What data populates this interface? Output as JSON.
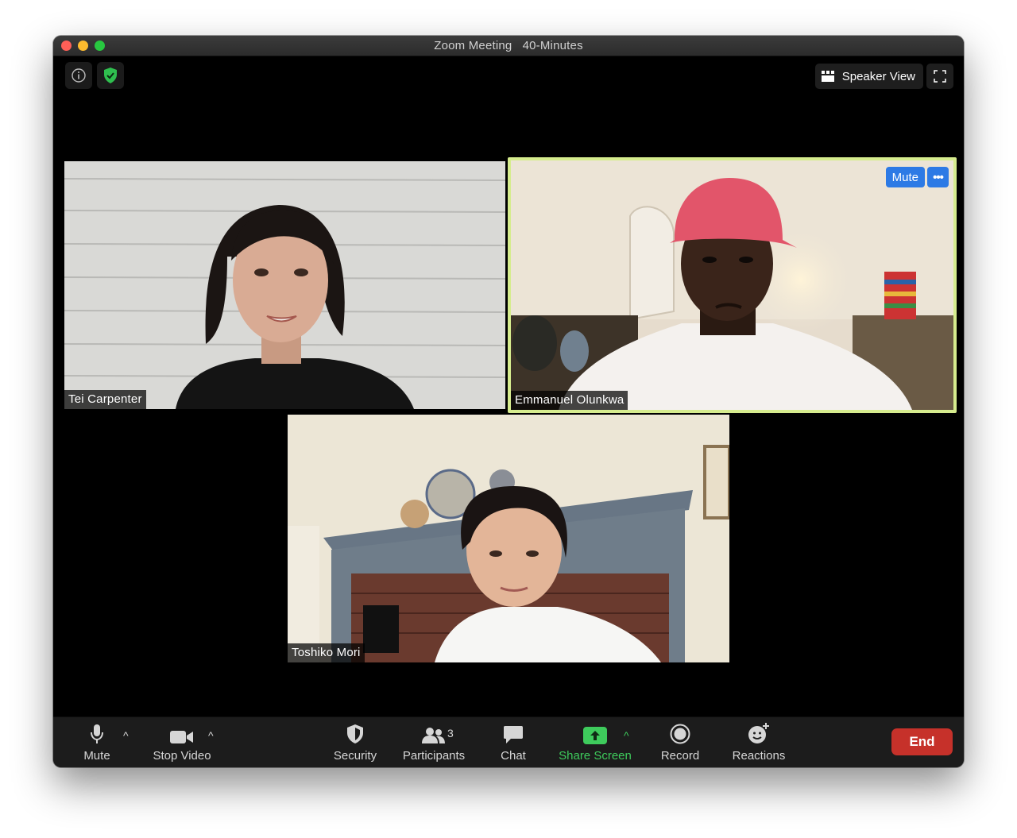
{
  "window": {
    "title": "Zoom Meeting   40-Minutes"
  },
  "top_controls": {
    "speaker_view_label": "Speaker View"
  },
  "participants": [
    {
      "name": "Tei Carpenter",
      "active_speaker": false
    },
    {
      "name": "Emmanuel Olunkwa",
      "active_speaker": true,
      "mute_label": "Mute",
      "more_label": "•••"
    },
    {
      "name": "Toshiko Mori",
      "active_speaker": false
    }
  ],
  "toolbar": {
    "mute_label": "Mute",
    "stop_video_label": "Stop Video",
    "security_label": "Security",
    "participants_label": "Participants",
    "participants_count": "3",
    "chat_label": "Chat",
    "share_screen_label": "Share Screen",
    "record_label": "Record",
    "reactions_label": "Reactions",
    "end_label": "End"
  },
  "colors": {
    "active_speaker_border": "#d6ec8e",
    "share_screen_green": "#3ecb5c",
    "end_red": "#c6312a",
    "mute_blue": "#2d7ae5"
  }
}
